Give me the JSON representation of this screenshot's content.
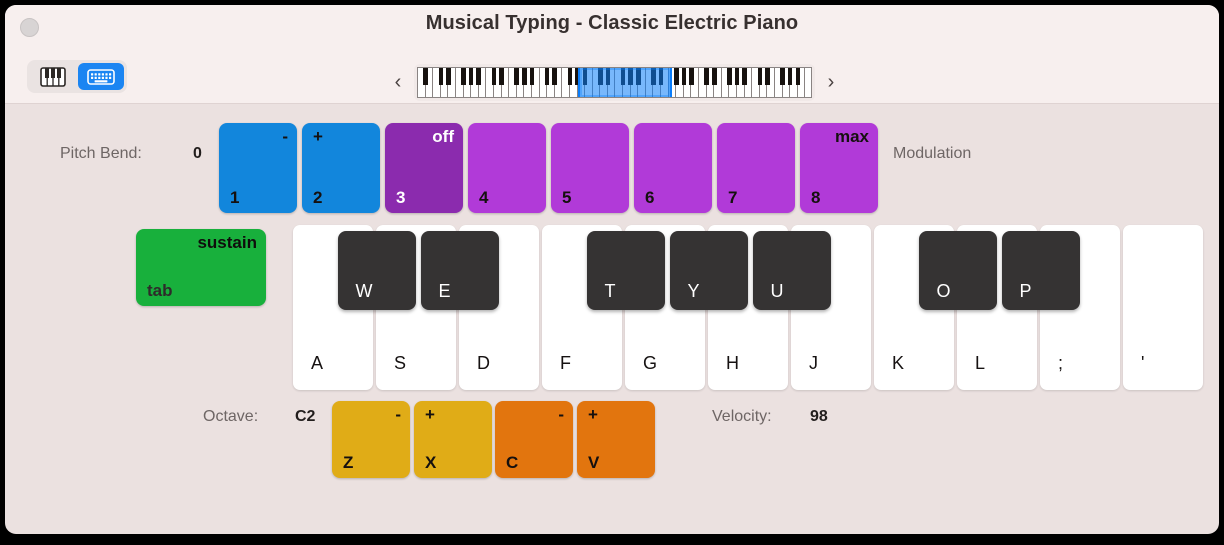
{
  "window": {
    "title": "Musical Typing - Classic Electric Piano"
  },
  "toolbar": {
    "piano_icon": "piano-keys-icon",
    "keyboard_icon": "computer-keyboard-icon",
    "active_mode": "keyboard",
    "prev_arrow": "‹",
    "next_arrow": "›"
  },
  "pitch_bend": {
    "label": "Pitch Bend:",
    "value": "0"
  },
  "modulation": {
    "label": "Modulation"
  },
  "octave": {
    "label": "Octave:",
    "value": "C2"
  },
  "velocity": {
    "label": "Velocity:",
    "value": "98"
  },
  "colors": {
    "pitch_bend_key": "#1286DC",
    "modulation_key": "#B13AD8",
    "modulation_key_active": "#8B2BAE",
    "sustain_key": "#18B03C",
    "octave_key": "#E0AC17",
    "velocity_key": "#E2750E",
    "white_key": "#FFFFFF",
    "black_key": "#353333",
    "accent": "#1B85F2",
    "window_bg": "#EBE1E0",
    "toolbar_bg": "#F7EFEE"
  },
  "top_row_keys": [
    {
      "number": "1",
      "top_label": "-",
      "group": "pitch-bend",
      "active": false
    },
    {
      "number": "2",
      "top_label": "+",
      "group": "pitch-bend",
      "active": false
    },
    {
      "number": "3",
      "top_label": "off",
      "group": "modulation",
      "active": true
    },
    {
      "number": "4",
      "top_label": "",
      "group": "modulation",
      "active": false
    },
    {
      "number": "5",
      "top_label": "",
      "group": "modulation",
      "active": false
    },
    {
      "number": "6",
      "top_label": "",
      "group": "modulation",
      "active": false
    },
    {
      "number": "7",
      "top_label": "",
      "group": "modulation",
      "active": false
    },
    {
      "number": "8",
      "top_label": "max",
      "group": "modulation",
      "active": false
    }
  ],
  "sustain_key": {
    "top_label": "sustain",
    "bottom_label": "tab"
  },
  "white_keys": [
    {
      "label": "A"
    },
    {
      "label": "S"
    },
    {
      "label": "D"
    },
    {
      "label": "F"
    },
    {
      "label": "G"
    },
    {
      "label": "H"
    },
    {
      "label": "J"
    },
    {
      "label": "K"
    },
    {
      "label": "L"
    },
    {
      "label": ";"
    },
    {
      "label": "'"
    }
  ],
  "black_keys": [
    {
      "label": "W"
    },
    {
      "label": "E"
    },
    {
      "label": "T"
    },
    {
      "label": "Y"
    },
    {
      "label": "U"
    },
    {
      "label": "O"
    },
    {
      "label": "P"
    }
  ],
  "bottom_row_keys": [
    {
      "letter": "Z",
      "top_label": "-",
      "group": "octave"
    },
    {
      "letter": "X",
      "top_label": "+",
      "group": "octave"
    },
    {
      "letter": "C",
      "top_label": "-",
      "group": "velocity"
    },
    {
      "letter": "V",
      "top_label": "+",
      "group": "velocity"
    }
  ]
}
